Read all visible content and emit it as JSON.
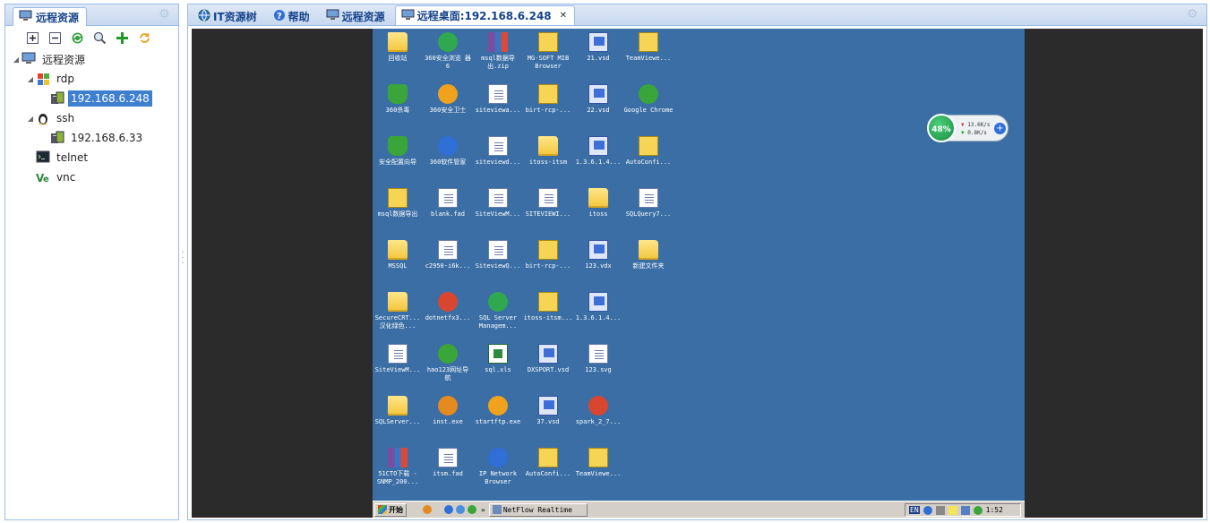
{
  "left_panel": {
    "title": "远程资源",
    "toolbar": [
      "expand-all",
      "collapse-all",
      "refresh",
      "search",
      "add",
      "reload"
    ],
    "tree": {
      "root": "远程资源",
      "rdp": {
        "label": "rdp",
        "hosts": [
          "192.168.6.248"
        ]
      },
      "ssh": {
        "label": "ssh",
        "hosts": [
          "192.168.6.33"
        ]
      },
      "telnet": {
        "label": "telnet"
      },
      "vnc": {
        "label": "vnc"
      }
    }
  },
  "tabs": [
    {
      "label": "IT资源树",
      "icon": "globe-icon"
    },
    {
      "label": "帮助",
      "icon": "help-icon"
    },
    {
      "label": "远程资源",
      "icon": "monitor-icon"
    },
    {
      "label": "远程桌面:192.168.6.248",
      "icon": "monitor-icon",
      "active": true
    }
  ],
  "desktop": {
    "columns": [
      [
        "回收站",
        "360杀毒",
        "安全配置向导",
        "msql数据导出",
        "MSSQL",
        "SecureCRT... 汉化绿色...",
        "SiteViewM...",
        "SQLServer...",
        "51CTO下载 -SNMP_200..."
      ],
      [
        "360安全浏览 器6",
        "360安全卫士",
        "360软件管家",
        "blank.fad",
        "c2950-i6k...",
        "dotnetfx3...",
        "hao123网址导 航",
        "inst.exe",
        "itsm.fad"
      ],
      [
        "msql数据导 出.zip",
        "siteviewa...",
        "siteviewd...",
        "SiteViewM...",
        "SiteviewQ...",
        "SQL Server Managem...",
        "sql.xls",
        "startftp.exe",
        "IP Network Browser"
      ],
      [
        "MG-SOFT MIB Browser",
        "birt-rcp-...",
        "itoss-itsm",
        "SITEVIEWI...",
        "birt-rcp-...",
        "itoss-itsm...",
        "DXSPORT.vsd",
        "37.vsd",
        "AutoConfi..."
      ],
      [
        "21.vsd",
        "22.vsd",
        "1.3.6.1.4...",
        "itoss",
        "123.vdx",
        "1.3.6.1.4...",
        "123.svg",
        "spark_2_7...",
        "TeamViewe..."
      ],
      [
        "TeamViewe...",
        "Google Chrome",
        "AutoConfi...",
        "SQLQuery7...",
        "新建文件夹"
      ]
    ],
    "taskbar": {
      "start_label": "开始",
      "task_label": "NetFlow Realtime",
      "lang": "EN",
      "clock": "1:52"
    },
    "net_widget": {
      "percent": "48%",
      "up": "13.6K/s",
      "down": "0.8K/s"
    }
  }
}
